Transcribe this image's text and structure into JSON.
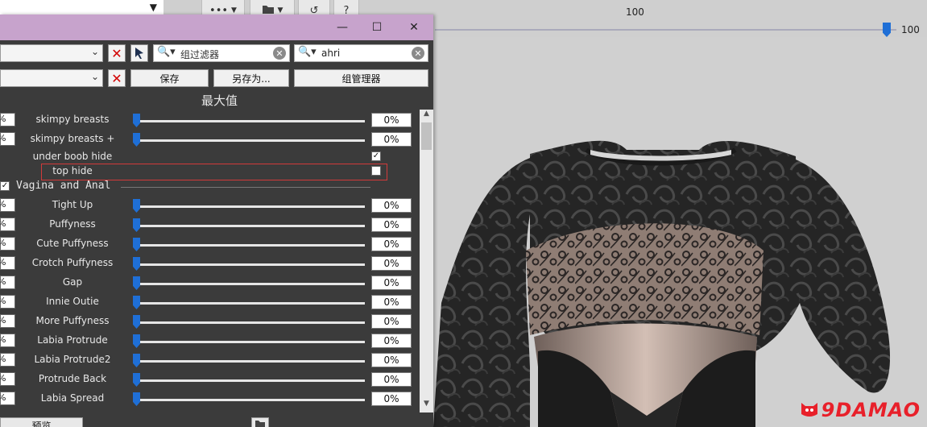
{
  "main_toolbar": {
    "more_icon": "ellipsis-icon",
    "folder_icon": "folder-icon",
    "undo_icon": "undo-icon",
    "help_icon": "help-icon",
    "slider_label": "100",
    "slider_value": "100",
    "slider_level": 1.0
  },
  "panel": {
    "window_controls": {
      "minimize": "—",
      "maximize": "☐",
      "close": "✕"
    },
    "filter1": {
      "placeholder": "组过滤器"
    },
    "filter2": {
      "value": "ahri"
    },
    "buttons": {
      "save": "保存",
      "save_as": "另存为...",
      "group_manager": "组管理器"
    },
    "section_title": "最大值",
    "rows_top": [
      {
        "name": "skimpy breasts",
        "value": "0%"
      },
      {
        "name": "skimpy breasts +",
        "value": "0%"
      }
    ],
    "checks": [
      {
        "name": "under boob hide",
        "checked": "✓"
      },
      {
        "name": "top hide",
        "checked": ""
      }
    ],
    "category": {
      "label": "Vagina and Anal",
      "checked": "✓"
    },
    "rows": [
      {
        "name": "Tight Up",
        "value": "0%"
      },
      {
        "name": "Puffyness",
        "value": "0%"
      },
      {
        "name": "Cute Puffyness",
        "value": "0%"
      },
      {
        "name": "Crotch Puffyness",
        "value": "0%"
      },
      {
        "name": "Gap",
        "value": "0%"
      },
      {
        "name": "Innie Outie",
        "value": "0%"
      },
      {
        "name": "More Puffyness",
        "value": "0%"
      },
      {
        "name": "Labia Protrude",
        "value": "0%"
      },
      {
        "name": "Labia Protrude2",
        "value": "0%"
      },
      {
        "name": "Protrude Back",
        "value": "0%"
      },
      {
        "name": "Labia Spread",
        "value": "0%"
      }
    ],
    "bottom_button": "预览",
    "left_box_text": "%"
  },
  "watermark": {
    "text": "9DAMAO"
  },
  "colors": {
    "titlebar": "#c7a3cc",
    "panel_bg": "#3b3b3b",
    "accent": "#1f6fd6",
    "highlight": "#d23a3a",
    "watermark": "#e8202a"
  }
}
